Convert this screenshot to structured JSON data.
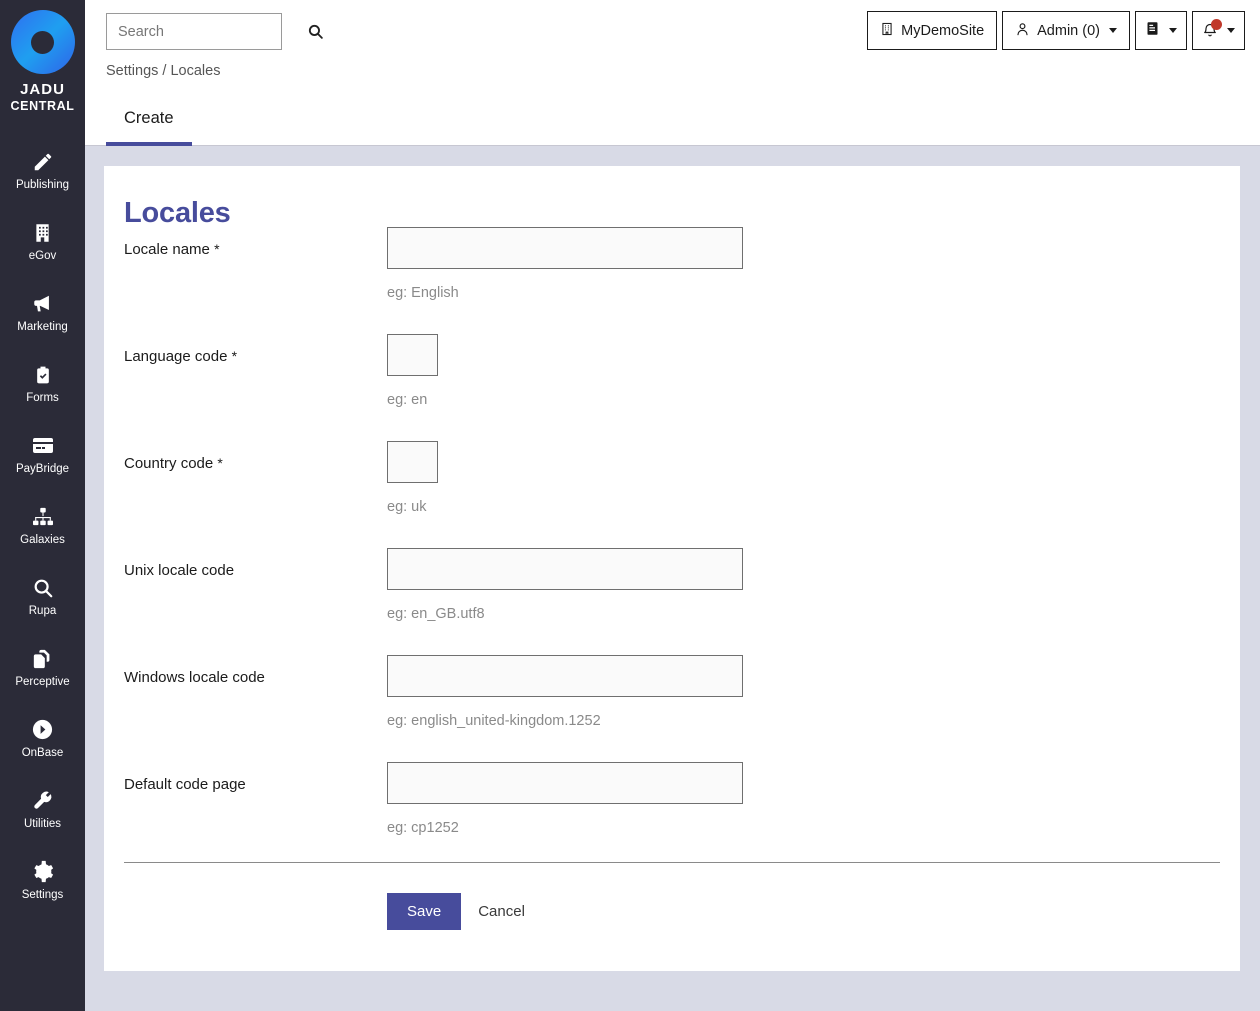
{
  "brand": {
    "line1": "JADU",
    "line2": "CENTRAL",
    "logo_icon": "jadu-ring-logo"
  },
  "sidebar": {
    "items": [
      {
        "label": "Publishing",
        "icon": "pencil-icon"
      },
      {
        "label": "eGov",
        "icon": "building-icon"
      },
      {
        "label": "Marketing",
        "icon": "megaphone-icon"
      },
      {
        "label": "Forms",
        "icon": "clipboard-check-icon"
      },
      {
        "label": "PayBridge",
        "icon": "credit-card-icon"
      },
      {
        "label": "Galaxies",
        "icon": "sitemap-icon"
      },
      {
        "label": "Rupa",
        "icon": "magnifier-icon"
      },
      {
        "label": "Perceptive",
        "icon": "documents-icon"
      },
      {
        "label": "OnBase",
        "icon": "circle-arrow-right-icon"
      },
      {
        "label": "Utilities",
        "icon": "wrench-icon"
      },
      {
        "label": "Settings",
        "icon": "gear-icon"
      }
    ]
  },
  "header": {
    "search": {
      "value": "",
      "placeholder": "Search",
      "icon": "search-icon"
    },
    "breadcrumb": "Settings / Locales",
    "site_button": {
      "label": "MyDemoSite",
      "icon": "building-icon"
    },
    "admin_button": {
      "label": "Admin (0)",
      "icon": "user-icon",
      "caret": "chevron-down-icon"
    },
    "docs_button": {
      "icon": "book-icon",
      "caret": "chevron-down-icon"
    },
    "notifications_button": {
      "icon": "bell-icon",
      "caret": "chevron-down-icon",
      "badge_color": "#c0392b"
    }
  },
  "tabs": [
    {
      "label": "Create",
      "active": true
    }
  ],
  "card": {
    "title": "Locales",
    "fields": [
      {
        "label": "Locale name",
        "required": true,
        "value": "",
        "hint": "eg: English",
        "size": "wide"
      },
      {
        "label": "Language code",
        "required": true,
        "value": "",
        "hint": "eg: en",
        "size": "narrow"
      },
      {
        "label": "Country code",
        "required": true,
        "value": "",
        "hint": "eg: uk",
        "size": "narrow"
      },
      {
        "label": "Unix locale code",
        "required": false,
        "value": "",
        "hint": "eg: en_GB.utf8",
        "size": "wide"
      },
      {
        "label": "Windows locale code",
        "required": false,
        "value": "",
        "hint": "eg: english_united-kingdom.1252",
        "size": "wide"
      },
      {
        "label": "Default code page",
        "required": false,
        "value": "",
        "hint": "eg: cp1252",
        "size": "wide"
      }
    ],
    "save_label": "Save",
    "cancel_label": "Cancel"
  },
  "colors": {
    "accent": "#474c9c",
    "sidebar_bg": "#2b2b38",
    "page_bg": "#d8dae6",
    "badge_red": "#c0392b"
  }
}
